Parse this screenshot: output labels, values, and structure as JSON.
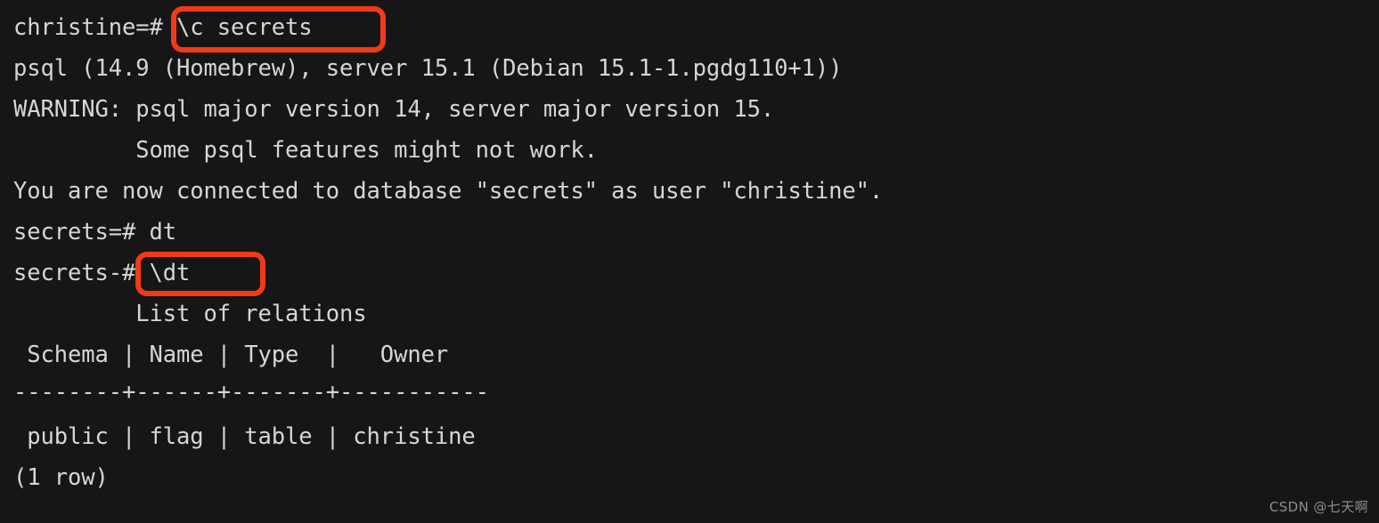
{
  "terminal": {
    "background_color": "#161616",
    "text_color": "#d6d6d6",
    "annotation_color": "#f23a17",
    "lines": [
      "christine=# \\c secrets",
      "psql (14.9 (Homebrew), server 15.1 (Debian 15.1-1.pgdg110+1))",
      "WARNING: psql major version 14, server major version 15.",
      "         Some psql features might not work.",
      "You are now connected to database \"secrets\" as user \"christine\".",
      "secrets=# dt",
      "secrets-# \\dt",
      "         List of relations",
      " Schema | Name | Type  |   Owner",
      "--------+------+-------+-----------",
      " public | flag | table | christine",
      "(1 row)"
    ],
    "prompts": {
      "initial": "christine=#",
      "connected": "secrets=#",
      "continuation": "secrets-#"
    },
    "commands": {
      "connect": "\\c secrets",
      "list_tables": "\\dt",
      "mistyped": "dt"
    },
    "psql_version_line": "psql (14.9 (Homebrew), server 15.1 (Debian 15.1-1.pgdg110+1))",
    "warning_line": "WARNING: psql major version 14, server major version 15.",
    "warning_detail": "         Some psql features might not work.",
    "connected_line": "You are now connected to database \"secrets\" as user \"christine\".",
    "table": {
      "caption": "         List of relations",
      "header": " Schema | Name | Type  |   Owner",
      "separator": "--------+------+-------+-----------",
      "rows": [
        " public | flag | table | christine"
      ],
      "columns": [
        "Schema",
        "Name",
        "Type",
        "Owner"
      ],
      "cells": [
        [
          "public",
          "flag",
          "table",
          "christine"
        ]
      ],
      "row_count_label": "(1 row)"
    },
    "annotations": [
      {
        "label": "\\c secrets"
      },
      {
        "label": "\\dt"
      }
    ]
  },
  "watermark": {
    "text": "CSDN @七天啊"
  }
}
